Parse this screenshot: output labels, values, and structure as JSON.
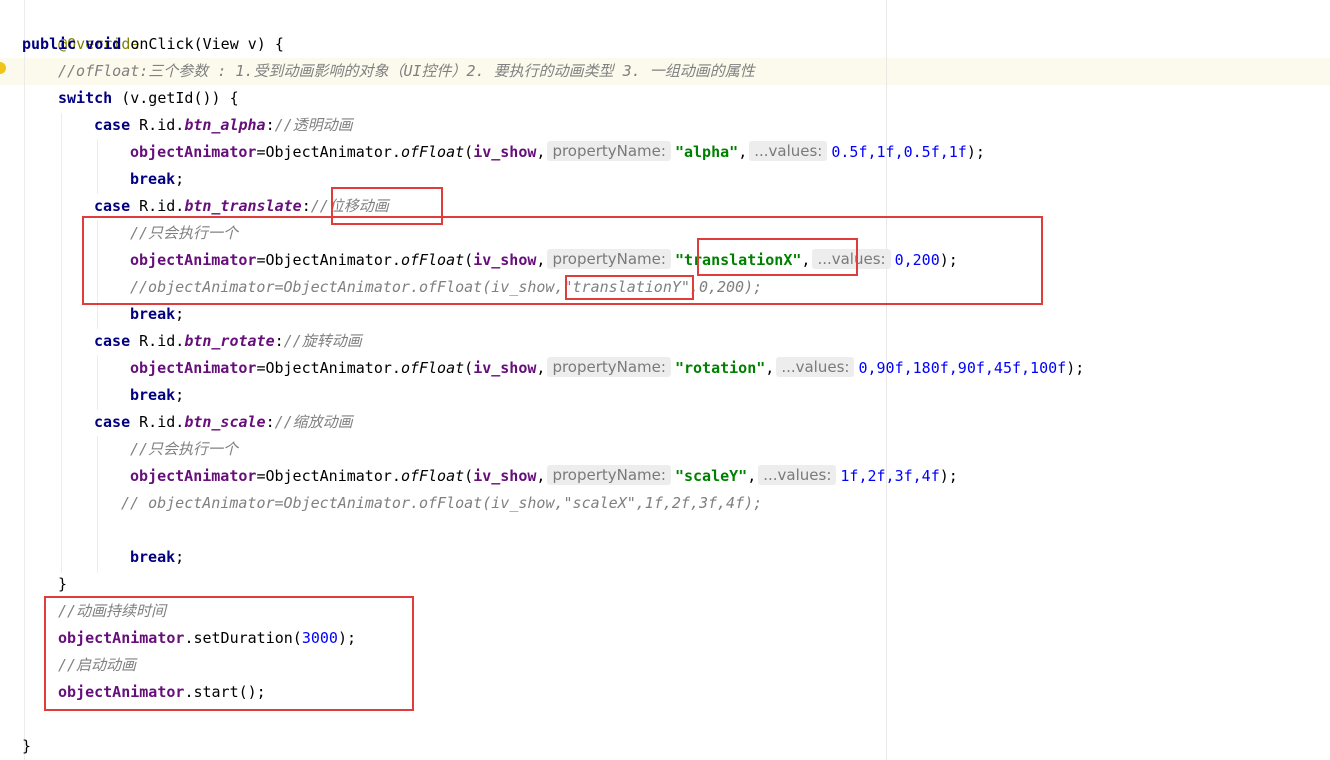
{
  "editor": {
    "lines": [
      {
        "annotation": "@Override"
      },
      {
        "kw_public": "public",
        "kw_void": "void",
        "method": " onClick(View v) {"
      },
      {
        "comment": "//ofFloat:三个参数 : 1.受到动画影响的对象（UI控件）2. 要执行的动画类型 3. 一组动画的属性"
      },
      {
        "kw": "switch",
        "text": " (v.getId()) {"
      },
      {
        "kw": "case",
        "prefix": " R.id.",
        "id": "btn_alpha",
        "colon": ":",
        "comment": "//透明动画"
      },
      {
        "field": "objectAnimator",
        "eq": "=ObjectAnimator.",
        "method": "ofFloat",
        "open": "(",
        "arg": "iv_show",
        "comma": ",",
        "hint1": "propertyName:",
        "str": "\"alpha\"",
        "comma2": ",",
        "hint2": "...values:",
        "nums": "0.5f,1f,0.5f,1f",
        "close": ");"
      },
      {
        "kw": "break",
        "semi": ";"
      },
      {
        "kw": "case",
        "prefix": " R.id.",
        "id": "btn_translate",
        "colon": ":",
        "comment": "//位移动画"
      },
      {
        "comment": "//只会执行一个"
      },
      {
        "field": "objectAnimator",
        "eq": "=ObjectAnimator.",
        "method": "ofFloat",
        "open": "(",
        "arg": "iv_show",
        "comma": ",",
        "hint1": "propertyName:",
        "str": "\"translationX\"",
        "comma2": ",",
        "hint2": "...values:",
        "nums": "0,200",
        "close": ");"
      },
      {
        "comment": "//objectAnimator=ObjectAnimator.ofFloat(iv_show,\"translationY\",0,200);"
      },
      {
        "kw": "break",
        "semi": ";"
      },
      {
        "kw": "case",
        "prefix": " R.id.",
        "id": "btn_rotate",
        "colon": ":",
        "comment": "//旋转动画"
      },
      {
        "field": "objectAnimator",
        "eq": "=ObjectAnimator.",
        "method": "ofFloat",
        "open": "(",
        "arg": "iv_show",
        "comma": ",",
        "hint1": "propertyName:",
        "str": "\"rotation\"",
        "comma2": ",",
        "hint2": "...values:",
        "nums": "0,90f,180f,90f,45f,100f",
        "close": ");"
      },
      {
        "kw": "break",
        "semi": ";"
      },
      {
        "kw": "case",
        "prefix": " R.id.",
        "id": "btn_scale",
        "colon": ":",
        "comment": "//缩放动画"
      },
      {
        "comment": "//只会执行一个"
      },
      {
        "field": "objectAnimator",
        "eq": "=ObjectAnimator.",
        "method": "ofFloat",
        "open": "(",
        "arg": "iv_show",
        "comma": ",",
        "hint1": "propertyName:",
        "str": "\"scaleY\"",
        "comma2": ",",
        "hint2": "...values:",
        "nums": "1f,2f,3f,4f",
        "close": ");"
      },
      {
        "comment": "// objectAnimator=ObjectAnimator.ofFloat(iv_show,\"scaleX\",1f,2f,3f,4f);"
      },
      {
        "kw": "break",
        "semi": ";"
      },
      {
        "text": "}"
      },
      {
        "comment": "//动画持续时间"
      },
      {
        "field": "objectAnimator",
        "text": ".setDuration(",
        "num": "3000",
        "close": ");"
      },
      {
        "comment": "//启动动画"
      },
      {
        "field": "objectAnimator",
        "text": ".start();"
      },
      {
        "text": "}"
      }
    ],
    "colors": {
      "keyword": "#000080",
      "string": "#008000",
      "field": "#660e7a",
      "number": "#0000ff",
      "comment": "#808080",
      "annotation": "#808000",
      "highlight_box": "#e03c3c",
      "current_line": "#fcfaed"
    },
    "icons": {
      "gutter": "intention-bulb-icon"
    }
  }
}
